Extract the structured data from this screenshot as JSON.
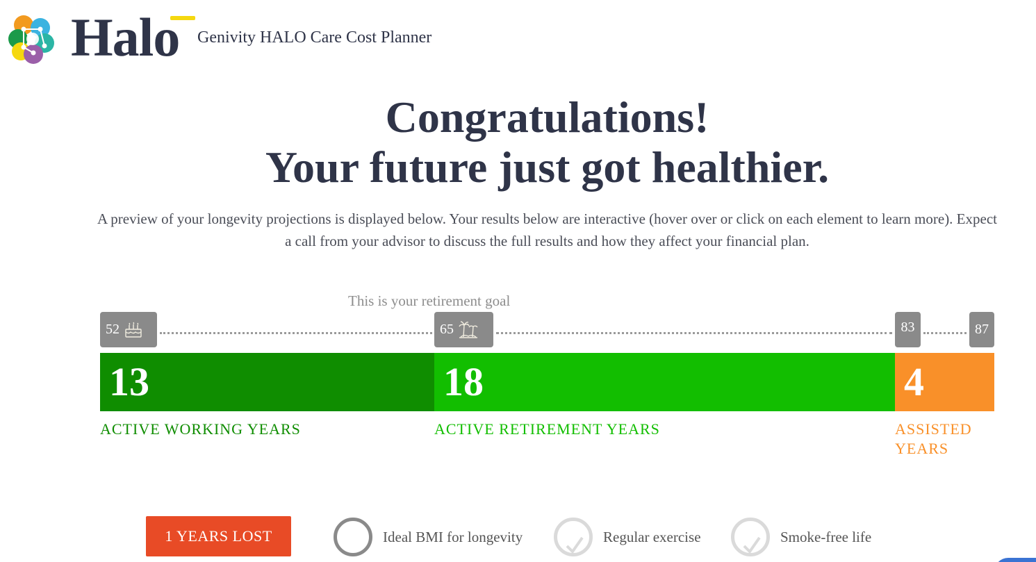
{
  "header": {
    "logo_text": "Halo",
    "app_title": "Genivity HALO Care Cost Planner"
  },
  "hero": {
    "line1": "Congratulations!",
    "line2": "Your future just got healthier.",
    "intro": "A preview of your longevity projections is displayed below. Your results below are interactive (hover over or click on each element to learn more). Expect a call from your advisor to discuss the full results and how they affect your financial plan."
  },
  "timeline": {
    "goal_text": "This is your retirement goal",
    "ages": {
      "current": "52",
      "current_icon": "cake-icon",
      "retirement": "65",
      "retirement_icon": "beach-icon",
      "assisted_start": "83",
      "end": "87"
    },
    "segments": [
      {
        "value": "13",
        "label": "ACTIVE WORKING YEARS",
        "color": "#0f8d00"
      },
      {
        "value": "18",
        "label": "ACTIVE RETIREMENT YEARS",
        "color": "#12be00"
      },
      {
        "value": "4",
        "label": "ASSISTED YEARS",
        "color": "#f99029"
      }
    ]
  },
  "factors": {
    "years_lost": "1 YEARS LOST",
    "years_lost_color": "#e84b26",
    "items": [
      {
        "label": "Ideal BMI for longevity",
        "state": "not-met"
      },
      {
        "label": "Regular exercise",
        "state": "met"
      },
      {
        "label": "Smoke-free life",
        "state": "met"
      }
    ]
  }
}
